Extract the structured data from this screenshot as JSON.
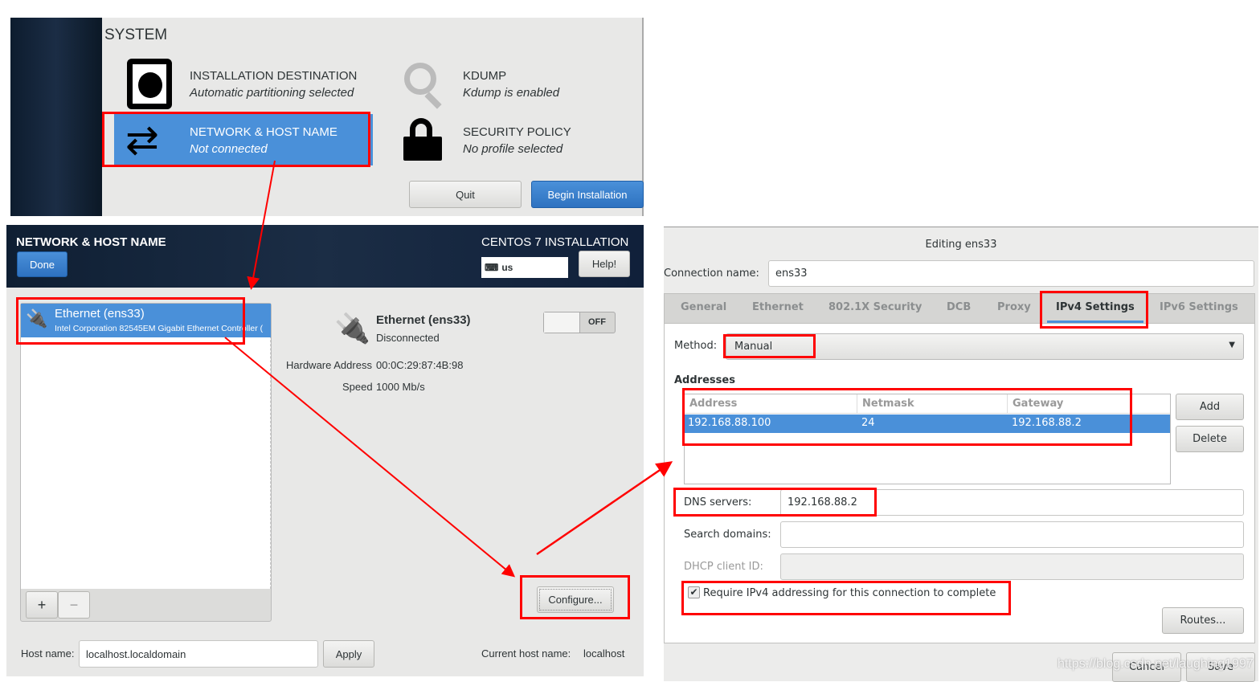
{
  "summary": {
    "section": "SYSTEM",
    "items": [
      {
        "title": "INSTALLATION DESTINATION",
        "status": "Automatic partitioning selected",
        "icon": "hard-disk-icon"
      },
      {
        "title": "KDUMP",
        "status": "Kdump is enabled",
        "icon": "kdump-magnifier-icon"
      },
      {
        "title": "NETWORK & HOST NAME",
        "status": "Not connected",
        "icon": "network-arrows-icon"
      },
      {
        "title": "SECURITY POLICY",
        "status": "No profile selected",
        "icon": "padlock-icon"
      }
    ],
    "quit": "Quit",
    "begin": "Begin Installation"
  },
  "network": {
    "header_title": "NETWORK & HOST NAME",
    "done": "Done",
    "product": "CENTOS 7 INSTALLATION",
    "keyboard": "us",
    "help": "Help!",
    "device_list": [
      {
        "name": "Ethernet (ens33)",
        "description": "Intel Corporation 82545EM Gigabit Ethernet Controller ("
      }
    ],
    "add": "+",
    "remove": "−",
    "detail": {
      "name": "Ethernet (ens33)",
      "state": "Disconnected",
      "toggle": "OFF",
      "hw_label": "Hardware Address",
      "hw_value": "00:0C:29:87:4B:98",
      "speed_label": "Speed",
      "speed_value": "1000 Mb/s"
    },
    "configure": "Configure...",
    "hostname_label": "Host name:",
    "hostname_value": "localhost.localdomain",
    "apply": "Apply",
    "current_label": "Current host name:",
    "current_value": "localhost"
  },
  "dialog": {
    "title": "Editing ens33",
    "conn_label": "Connection name:",
    "conn_value": "ens33",
    "tabs": [
      "General",
      "Ethernet",
      "802.1X Security",
      "DCB",
      "Proxy",
      "IPv4 Settings",
      "IPv6 Settings"
    ],
    "active_tab": "IPv4 Settings",
    "method_label": "Method:",
    "method_value": "Manual",
    "addresses_heading": "Addresses",
    "columns": [
      "Address",
      "Netmask",
      "Gateway"
    ],
    "rows": [
      [
        "192.168.88.100",
        "24",
        "192.168.88.2"
      ]
    ],
    "add": "Add",
    "delete": "Delete",
    "dns_label": "DNS servers:",
    "dns_value": "192.168.88.2",
    "search_label": "Search domains:",
    "search_value": "",
    "dhcp_label": "DHCP client ID:",
    "dhcp_value": "",
    "require_label": "Require IPv4 addressing for this connection to complete",
    "require_checked": true,
    "routes": "Routes...",
    "cancel": "Cancel",
    "save": "Save"
  },
  "watermark": "https://blog.csdn.net/laughing1997",
  "colors": {
    "accent": "#4a90d9",
    "annotation": "#ff0000",
    "header": "#1b2a40"
  }
}
